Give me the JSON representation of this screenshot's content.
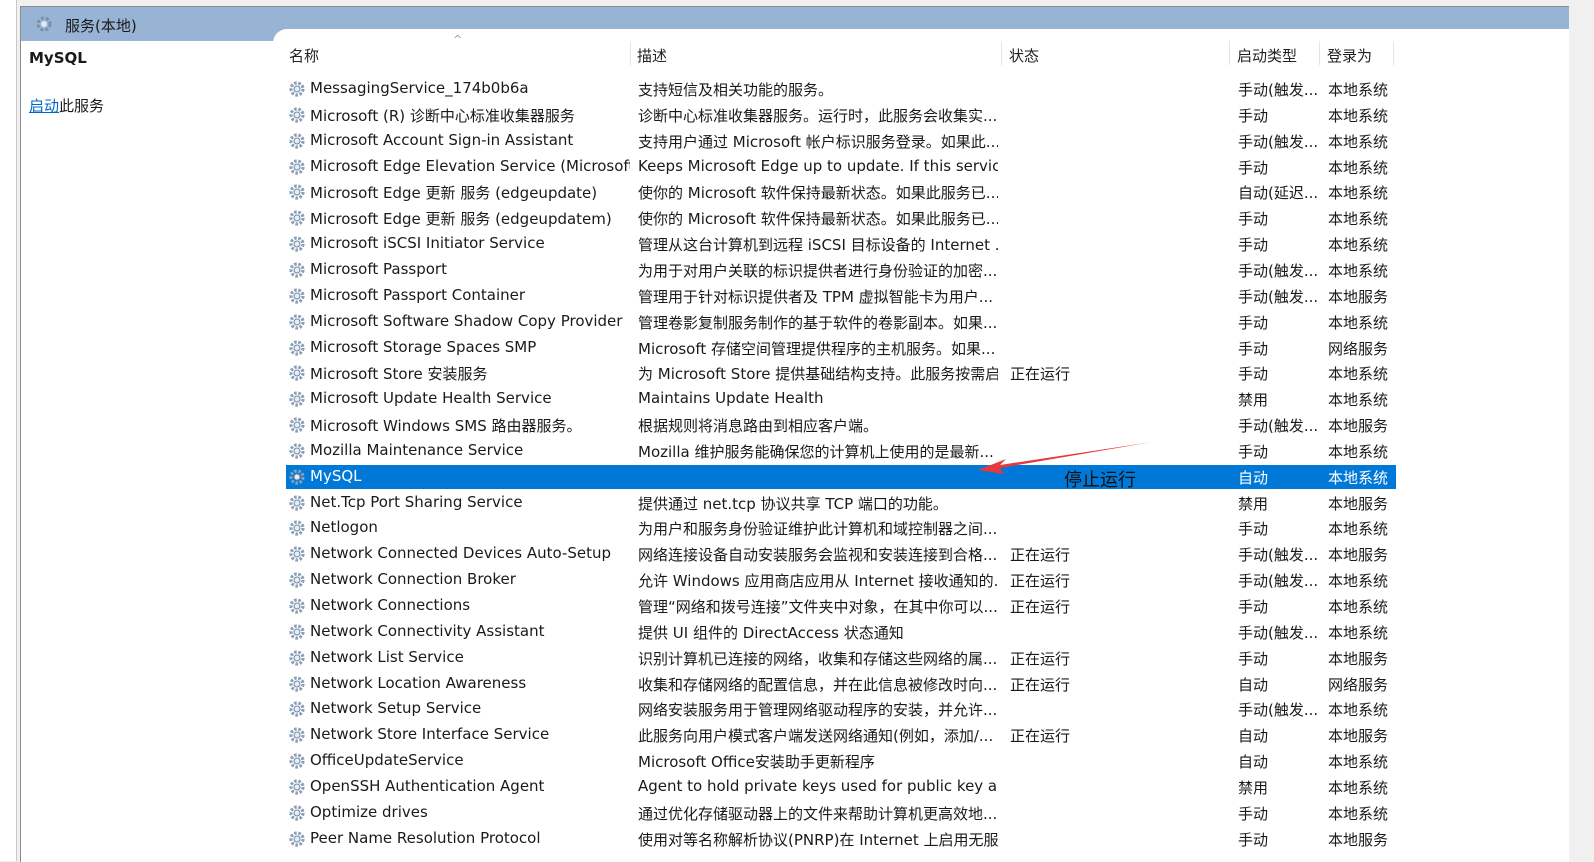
{
  "window": {
    "title": "服务(本地)"
  },
  "left_panel": {
    "service_name": "MySQL",
    "action_link": "启动",
    "action_suffix": "此服务"
  },
  "columns": [
    "名称",
    "描述",
    "状态",
    "启动类型",
    "登录为"
  ],
  "sort_indicator": "^",
  "rows": [
    [
      "MessagingService_174b0b6a",
      "支持短信及相关功能的服务。",
      "",
      "手动(触发...",
      "本地系统"
    ],
    [
      "Microsoft (R) 诊断中心标准收集器服务",
      "诊断中心标准收集器服务。运行时，此服务会收集实...",
      "",
      "手动",
      "本地系统"
    ],
    [
      "Microsoft Account Sign-in Assistant",
      "支持用户通过 Microsoft 帐户标识服务登录。如果此...",
      "",
      "手动(触发...",
      "本地系统"
    ],
    [
      "Microsoft Edge Elevation Service (MicrosoftEd...",
      "Keeps Microsoft Edge up to update. If this service is ...",
      "",
      "手动",
      "本地系统"
    ],
    [
      "Microsoft Edge 更新 服务 (edgeupdate)",
      "使你的 Microsoft 软件保持最新状态。如果此服务已...",
      "",
      "自动(延迟...",
      "本地系统"
    ],
    [
      "Microsoft Edge 更新 服务 (edgeupdatem)",
      "使你的 Microsoft 软件保持最新状态。如果此服务已...",
      "",
      "手动",
      "本地系统"
    ],
    [
      "Microsoft iSCSI Initiator Service",
      "管理从这台计算机到远程 iSCSI 目标设备的 Internet ...",
      "",
      "手动",
      "本地系统"
    ],
    [
      "Microsoft Passport",
      "为用于对用户关联的标识提供者进行身份验证的加密...",
      "",
      "手动(触发...",
      "本地系统"
    ],
    [
      "Microsoft Passport Container",
      "管理用于针对标识提供者及 TPM 虚拟智能卡为用户...",
      "",
      "手动(触发...",
      "本地服务"
    ],
    [
      "Microsoft Software Shadow Copy Provider",
      "管理卷影复制服务制作的基于软件的卷影副本。如果...",
      "",
      "手动",
      "本地系统"
    ],
    [
      "Microsoft Storage Spaces SMP",
      "Microsoft 存储空间管理提供程序的主机服务。如果...",
      "",
      "手动",
      "网络服务"
    ],
    [
      "Microsoft Store 安装服务",
      "为 Microsoft Store 提供基础结构支持。此服务按需启...",
      "正在运行",
      "手动",
      "本地系统"
    ],
    [
      "Microsoft Update Health Service",
      "Maintains Update Health",
      "",
      "禁用",
      "本地系统"
    ],
    [
      "Microsoft Windows SMS 路由器服务。",
      "根据规则将消息路由到相应客户端。",
      "",
      "手动(触发...",
      "本地服务"
    ],
    [
      "Mozilla Maintenance Service",
      "Mozilla 维护服务能确保您的计算机上使用的是最新...",
      "",
      "手动",
      "本地系统"
    ],
    [
      "MySQL",
      "",
      "",
      "自动",
      "本地系统"
    ],
    [
      "Net.Tcp Port Sharing Service",
      "提供通过 net.tcp 协议共享 TCP 端口的功能。",
      "",
      "禁用",
      "本地服务"
    ],
    [
      "Netlogon",
      "为用户和服务身份验证维护此计算机和域控制器之间...",
      "",
      "手动",
      "本地系统"
    ],
    [
      "Network Connected Devices Auto-Setup",
      "网络连接设备自动安装服务会监视和安装连接到合格...",
      "正在运行",
      "手动(触发...",
      "本地服务"
    ],
    [
      "Network Connection Broker",
      "允许 Windows 应用商店应用从 Internet 接收通知的...",
      "正在运行",
      "手动(触发...",
      "本地系统"
    ],
    [
      "Network Connections",
      "管理“网络和拨号连接”文件夹中对象，在其中你可以...",
      "正在运行",
      "手动",
      "本地系统"
    ],
    [
      "Network Connectivity Assistant",
      "提供 UI 组件的 DirectAccess 状态通知",
      "",
      "手动(触发...",
      "本地系统"
    ],
    [
      "Network List Service",
      "识别计算机已连接的网络，收集和存储这些网络的属...",
      "正在运行",
      "手动",
      "本地服务"
    ],
    [
      "Network Location Awareness",
      "收集和存储网络的配置信息，并在此信息被修改时向...",
      "正在运行",
      "自动",
      "网络服务"
    ],
    [
      "Network Setup Service",
      "网络安装服务用于管理网络驱动程序的安装，并允许...",
      "",
      "手动(触发...",
      "本地系统"
    ],
    [
      "Network Store Interface Service",
      "此服务向用户模式客户端发送网络通知(例如，添加/...",
      "正在运行",
      "自动",
      "本地服务"
    ],
    [
      "OfficeUpdateService",
      "Microsoft Office安装助手更新程序",
      "",
      "自动",
      "本地系统"
    ],
    [
      "OpenSSH Authentication Agent",
      "Agent to hold private keys used for public key authe...",
      "",
      "禁用",
      "本地系统"
    ],
    [
      "Optimize drives",
      "通过优化存储驱动器上的文件来帮助计算机更高效地...",
      "",
      "手动",
      "本地系统"
    ],
    [
      "Peer Name Resolution Protocol",
      "使用对等名称解析协议(PNRP)在 Internet 上启用无服...",
      "",
      "手动",
      "本地服务"
    ]
  ],
  "selected_index": 15,
  "annotation": {
    "text": "停止运行",
    "color": "#e8383d"
  },
  "colors": {
    "header": "#98b4d4",
    "selection": "#0078d7",
    "link": "#0066cc"
  }
}
